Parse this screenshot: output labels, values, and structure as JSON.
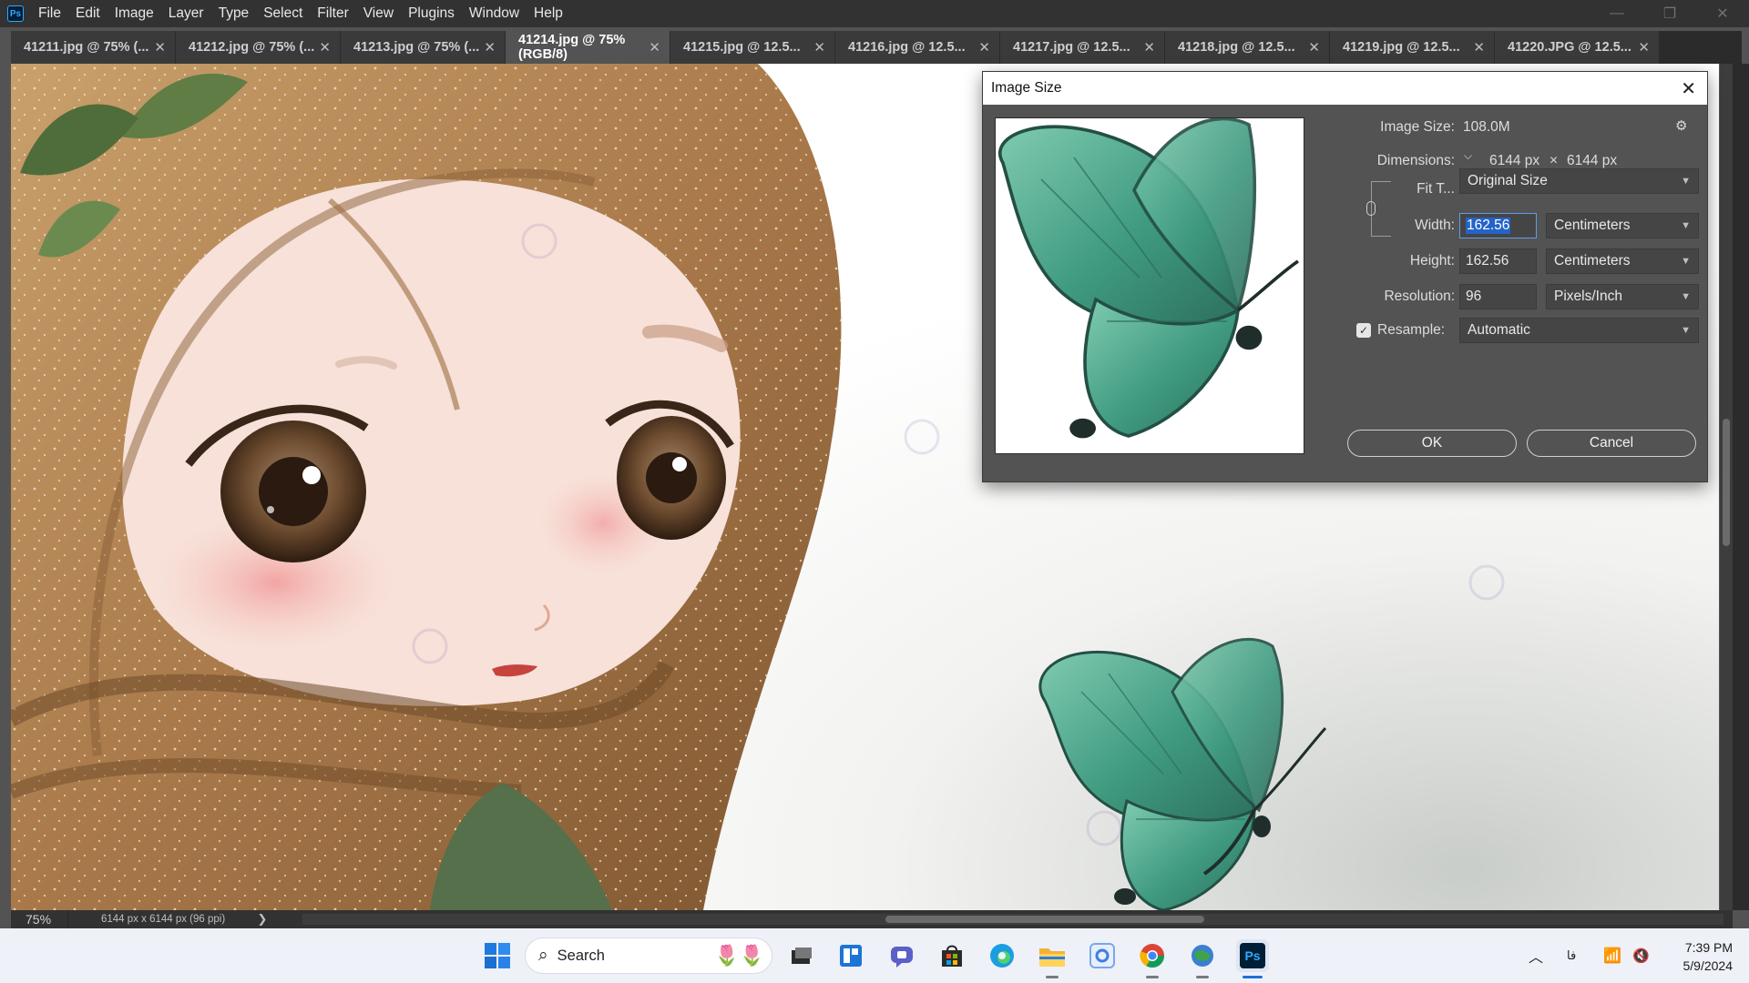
{
  "app": {
    "logo_text": "Ps"
  },
  "menu": [
    "File",
    "Edit",
    "Image",
    "Layer",
    "Type",
    "Select",
    "Filter",
    "View",
    "Plugins",
    "Window",
    "Help"
  ],
  "tabs": [
    {
      "label": "41211.jpg @ 75% (...",
      "active": false
    },
    {
      "label": "41212.jpg @ 75% (...",
      "active": false
    },
    {
      "label": "41213.jpg @ 75% (...",
      "active": false
    },
    {
      "label": "41214.jpg @ 75% (RGB/8)",
      "active": true
    },
    {
      "label": "41215.jpg @ 12.5...",
      "active": false
    },
    {
      "label": "41216.jpg @ 12.5...",
      "active": false
    },
    {
      "label": "41217.jpg @ 12.5...",
      "active": false
    },
    {
      "label": "41218.jpg @ 12.5...",
      "active": false
    },
    {
      "label": "41219.jpg @ 12.5...",
      "active": false
    },
    {
      "label": "41220.JPG @ 12.5...",
      "active": false
    }
  ],
  "status": {
    "zoom": "75%",
    "doc_info": "6144 px x 6144 px (96 ppi)",
    "arrow": "❯",
    "hs_arrow": "❮"
  },
  "dialog": {
    "title": "Image Size",
    "image_size_label": "Image Size:",
    "image_size_value": "108.0M",
    "dimensions_label": "Dimensions:",
    "dim_width": "6144 px",
    "dim_x": "×",
    "dim_height": "6144 px",
    "fit_label": "Fit T...",
    "fit_value": "Original Size",
    "width_label": "Width:",
    "width_value": "162.56",
    "width_unit": "Centimeters",
    "height_label": "Height:",
    "height_value": "162.56",
    "height_unit": "Centimeters",
    "resolution_label": "Resolution:",
    "resolution_value": "96",
    "resolution_unit": "Pixels/Inch",
    "resample_label": "Resample:",
    "resample_checked": true,
    "resample_value": "Automatic",
    "ok_label": "OK",
    "cancel_label": "Cancel"
  },
  "taskbar": {
    "search_placeholder": "Search",
    "tray_lang": "ﻓﺎ",
    "time": "7:39 PM",
    "date": "5/9/2024"
  },
  "colors": {
    "ps_blue": "#31a8ff",
    "selection_blue": "#2463c7",
    "butterfly_green": "#3f9a80",
    "scarf_gold": "#b68a56"
  },
  "icons": {
    "search": "search-icon",
    "gear": "gear-icon",
    "close": "close-icon",
    "link": "link-icon"
  }
}
